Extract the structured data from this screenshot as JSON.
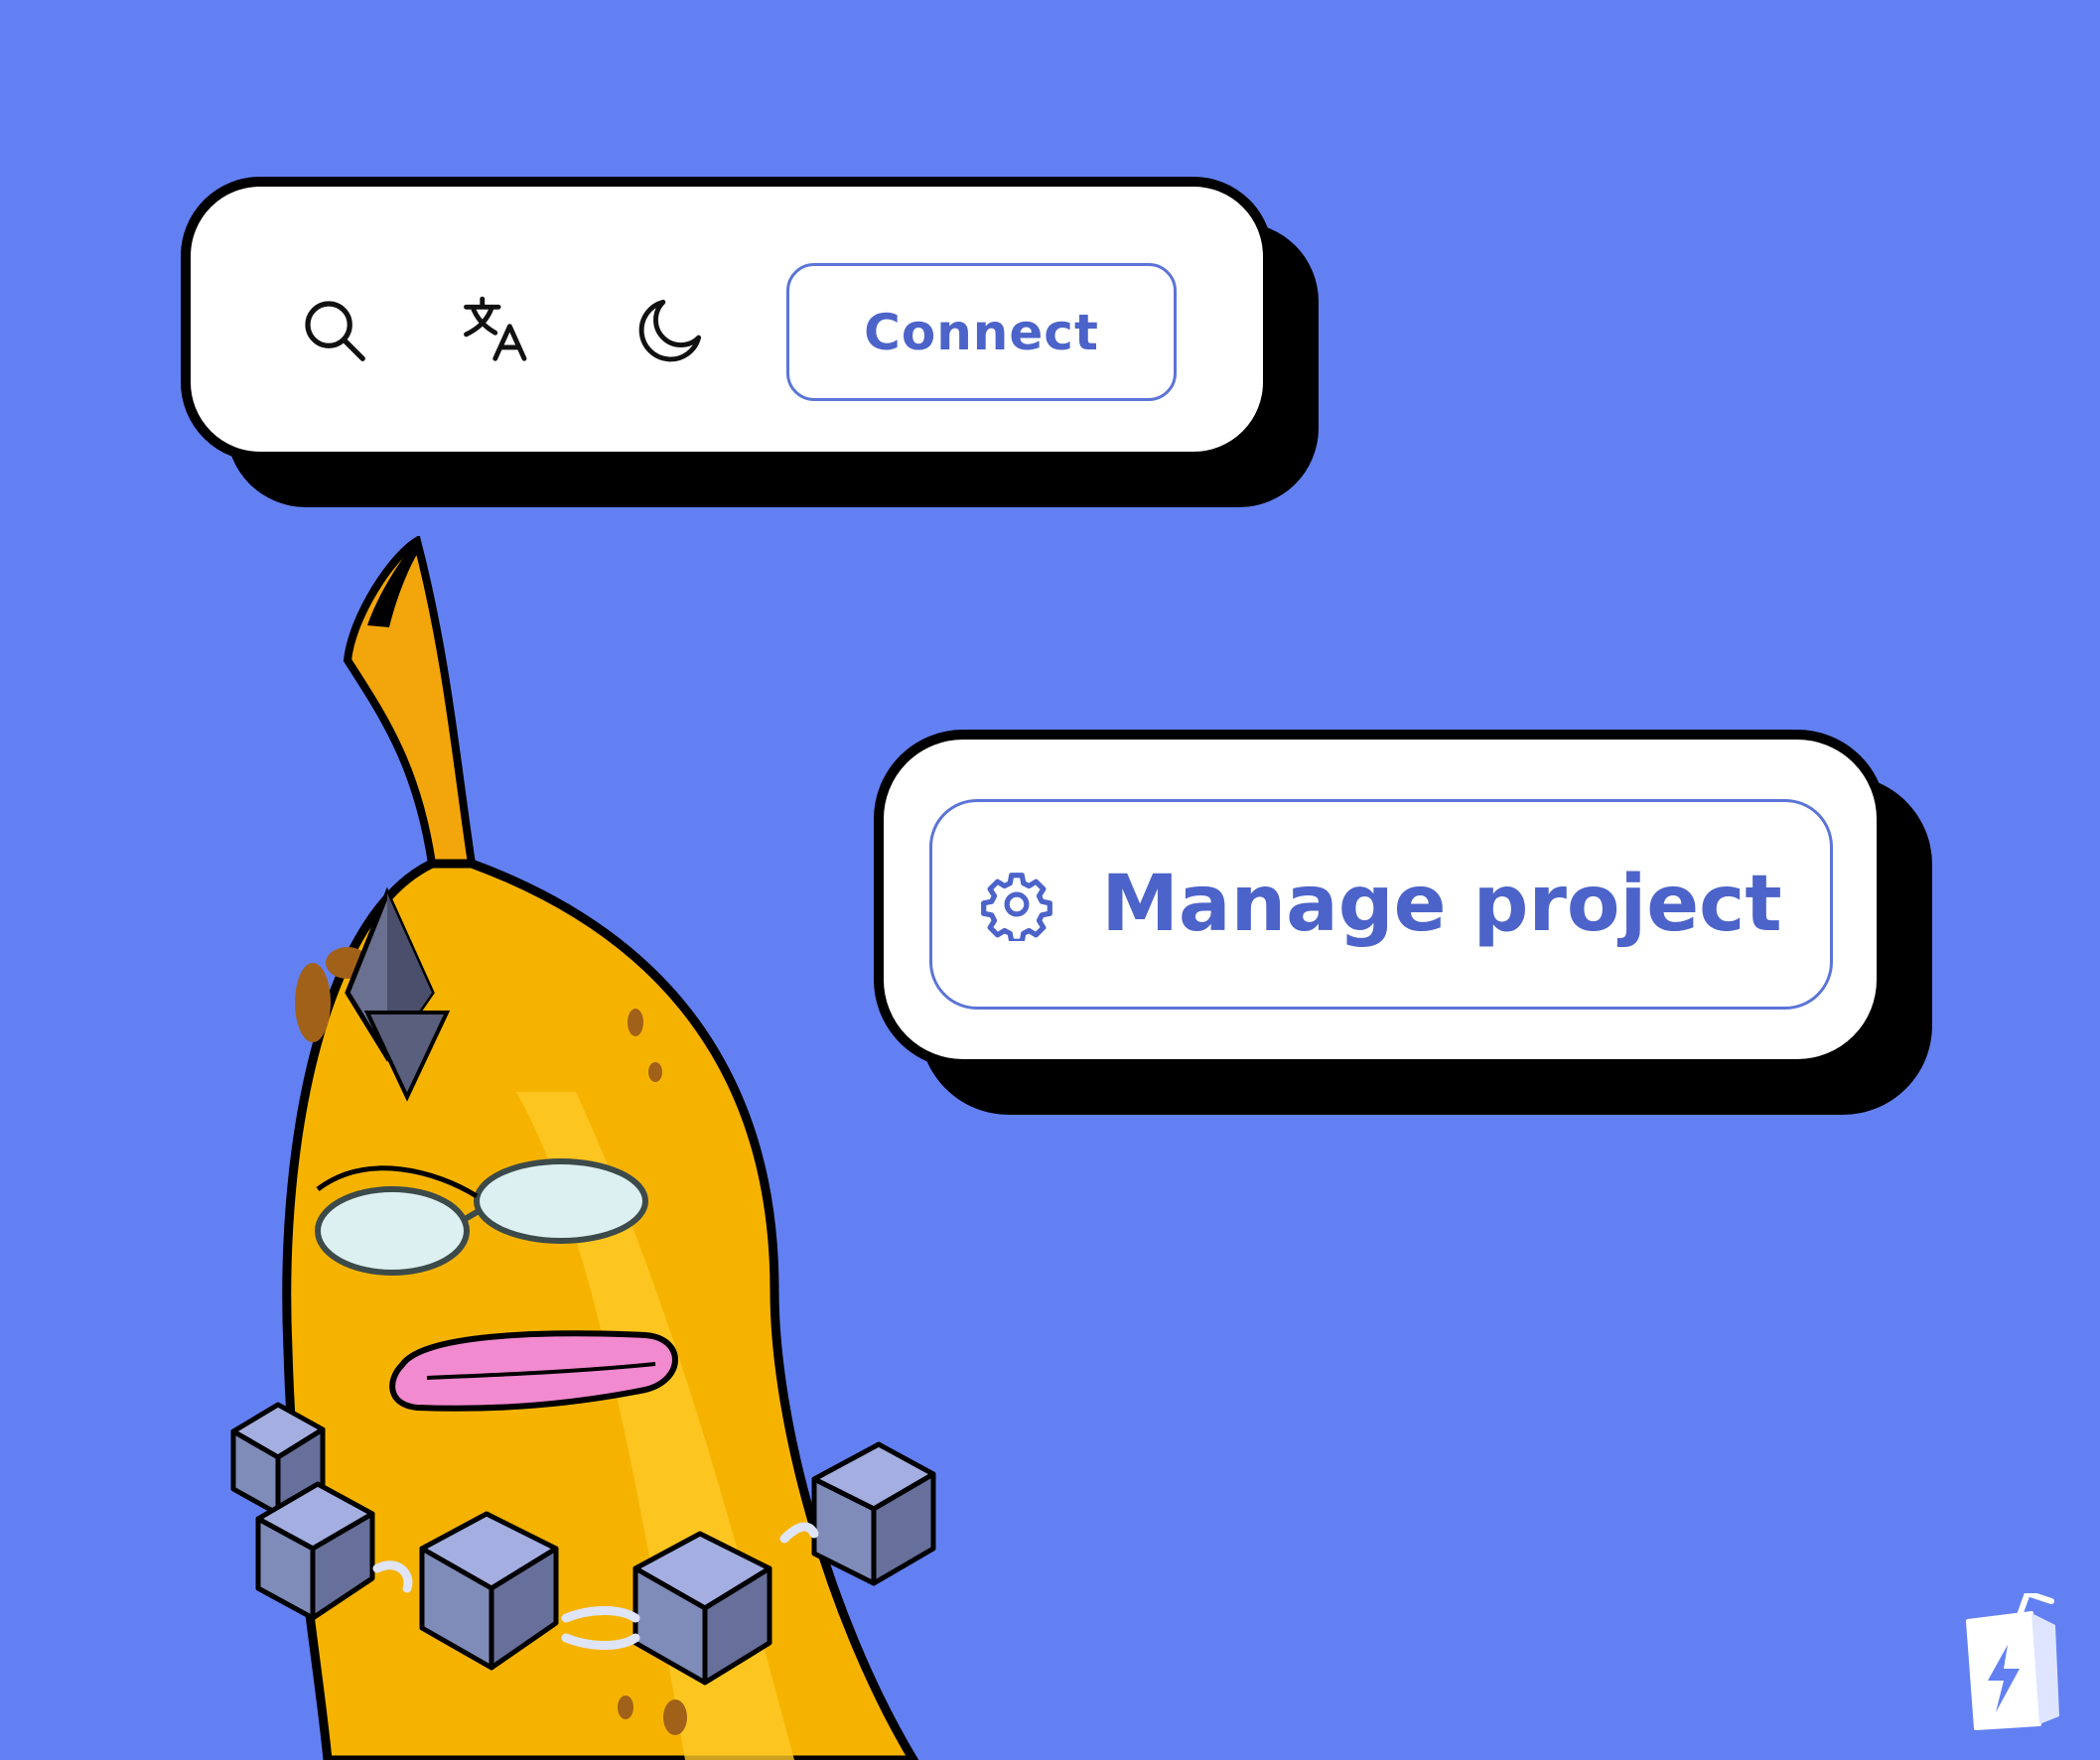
{
  "toolbar": {
    "icons": [
      "search-icon",
      "translate-icon",
      "moon-icon"
    ],
    "connect_label": "Connect"
  },
  "manage": {
    "icon": "gear-icon",
    "label": "Manage project"
  },
  "colors": {
    "background": "#6380f2",
    "accent": "#4c63c9",
    "card": "#ffffff",
    "shadow": "#000000",
    "banana": "#f6b800",
    "tongue": "#f08cd0",
    "blocks": "#7f8bb8"
  },
  "illustration": {
    "subject": "banana-mascot",
    "logo": "juicebox-logo"
  }
}
